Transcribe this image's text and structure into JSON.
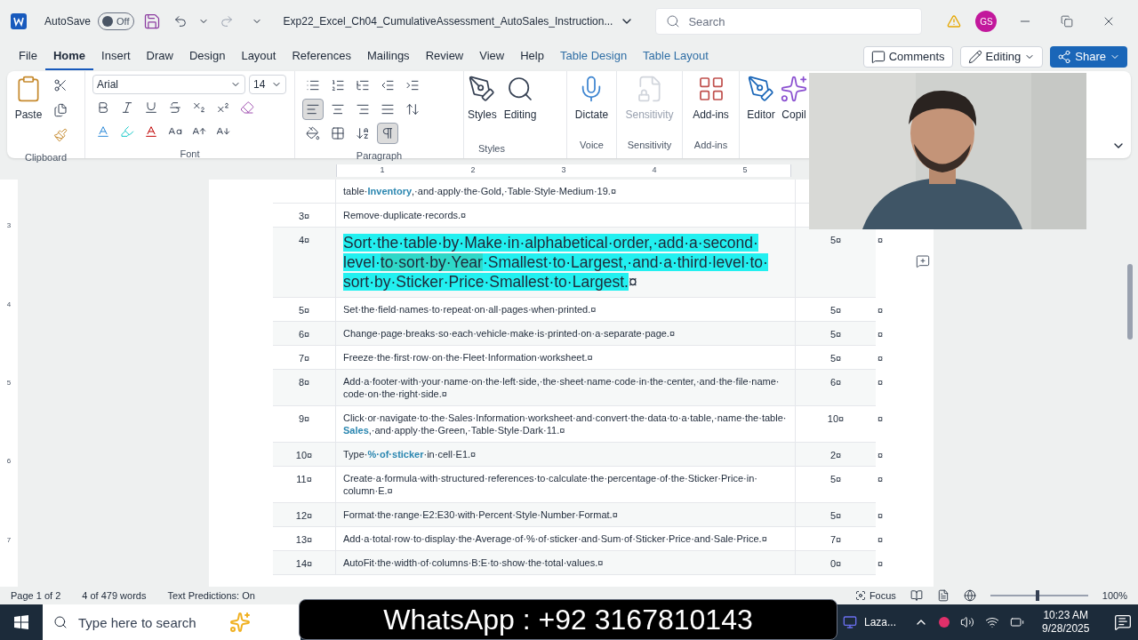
{
  "title_bar": {
    "autosave_label": "AutoSave",
    "autosave": {
      "on": false,
      "label": "Off"
    },
    "document_title": "Exp22_Excel_Ch04_CumulativeAssessment_AutoSales_Instruction...",
    "search": {
      "placeholder": "Search"
    },
    "avatar": "GS"
  },
  "tabs": [
    {
      "label": "File",
      "selected": false,
      "kind": "normal"
    },
    {
      "label": "Home",
      "selected": true,
      "kind": "normal"
    },
    {
      "label": "Insert",
      "selected": false,
      "kind": "normal"
    },
    {
      "label": "Draw",
      "selected": false,
      "kind": "normal"
    },
    {
      "label": "Design",
      "selected": false,
      "kind": "normal"
    },
    {
      "label": "Layout",
      "selected": false,
      "kind": "normal"
    },
    {
      "label": "References",
      "selected": false,
      "kind": "normal"
    },
    {
      "label": "Mailings",
      "selected": false,
      "kind": "normal"
    },
    {
      "label": "Review",
      "selected": false,
      "kind": "normal"
    },
    {
      "label": "View",
      "selected": false,
      "kind": "normal"
    },
    {
      "label": "Help",
      "selected": false,
      "kind": "normal"
    },
    {
      "label": "Table Design",
      "selected": false,
      "kind": "contextual"
    },
    {
      "label": "Table Layout",
      "selected": false,
      "kind": "contextual"
    }
  ],
  "tab_actions": {
    "comments": "Comments",
    "editing": "Editing",
    "share": "Share"
  },
  "ribbon": {
    "paste": "Paste",
    "font_name": "Arial",
    "font_size": "14",
    "align_buttons": [
      {
        "selected": true
      },
      {
        "selected": false
      },
      {
        "selected": false
      },
      {
        "selected": false
      }
    ],
    "show_marks": {
      "selected": true
    },
    "styles": "Styles",
    "editing": "Editing",
    "dictate": "Dictate",
    "sensitivity": {
      "label": "Sensitivity",
      "disabled": true
    },
    "addins": "Add-ins",
    "editor": "Editor",
    "copilot": "Copil",
    "group_labels": [
      "Clipboard",
      "Font",
      "Paragraph",
      "Styles",
      "Voice",
      "Sensitivity",
      "Add-ins"
    ]
  },
  "ruler": {
    "horizontal": [
      "1",
      "2",
      "3",
      "4",
      "5"
    ],
    "vertical": [
      "3",
      "4",
      "5",
      "6",
      "7"
    ]
  },
  "table": {
    "rows": [
      {
        "kind": "plain",
        "number": "",
        "text": "table·**Inventory**,·and·apply·the·Gold,·Table·Style·Medium·19.¤",
        "points": "",
        "end": ""
      },
      {
        "kind": "plain",
        "number": "3¤",
        "text": "Remove·duplicate·records.¤",
        "points": "",
        "end": ""
      },
      {
        "kind": "highlighted",
        "number": "4¤",
        "lines": [
          [
            {
              "text": "Sort·the·table·by·Make·in·alphabetical·order,·add·a·second·",
              "selected": false
            }
          ],
          [
            {
              "text": "level·",
              "selected": false
            },
            {
              "text": "to·sort·by·Year",
              "selected": true
            },
            {
              "text": "·Smallest·to·Largest,·and·a·third·level·to·",
              "selected": false
            }
          ],
          [
            {
              "text": "sort·by·Sticker·Price·Smallest·to·Largest.",
              "selected": false
            }
          ]
        ],
        "mark": "¤",
        "points": "5¤",
        "end": "¤"
      },
      {
        "kind": "plain",
        "number": "5¤",
        "text": "Set·the·field·names·to·repeat·on·all·pages·when·printed.¤",
        "points": "5¤",
        "end": "¤"
      },
      {
        "kind": "plain",
        "number": "6¤",
        "text": "Change·page·breaks·so·each·vehicle·make·is·printed·on·a·separate·page.¤",
        "points": "5¤",
        "end": "¤"
      },
      {
        "kind": "plain",
        "number": "7¤",
        "text": "Freeze·the·first·row·on·the·Fleet·Information·worksheet.¤",
        "points": "5¤",
        "end": "¤"
      },
      {
        "kind": "plain",
        "number": "8¤",
        "text": "Add·a·footer·with·your·name·on·the·left·side,·the·sheet·name·code·in·the·center,·and·the·file·name·code·on·the·right·side.¤",
        "points": "6¤",
        "end": "¤"
      },
      {
        "kind": "plain",
        "number": "9¤",
        "text": "Click·or·navigate·to·the·Sales·Information·worksheet·and·convert·the·data·to·a·table,·name·the·table·**Sales**,·and·apply·the·Green,·Table·Style·Dark·11.¤",
        "points": "10¤",
        "end": "¤"
      },
      {
        "kind": "plain",
        "number": "10¤",
        "text": "Type·**%·of·sticker**·in·cell·E1.¤",
        "points": "2¤",
        "end": "¤"
      },
      {
        "kind": "plain",
        "number": "11¤",
        "text": "Create·a·formula·with·structured·references·to·calculate·the·percentage·of·the·Sticker·Price·in·column·E.¤",
        "points": "5¤",
        "end": "¤"
      },
      {
        "kind": "plain",
        "number": "12¤",
        "text": "Format·the·range·E2:E30·with·Percent·Style·Number·Format.¤",
        "points": "5¤",
        "end": "¤"
      },
      {
        "kind": "plain",
        "number": "13¤",
        "text": "Add·a·total·row·to·display·the·Average·of·%·of·sticker·and·Sum·of·Sticker·Price·and·Sale·Price.¤",
        "points": "7¤",
        "end": "¤"
      },
      {
        "kind": "plain",
        "number": "14¤",
        "text": "AutoFit·the·width·of·columns·B:E·to·show·the·total·values.¤",
        "points": "0¤",
        "end": "¤"
      }
    ]
  },
  "status_bar": {
    "page": "Page 1 of 2",
    "words": "4 of 479 words",
    "predictions": "Text Predictions: On",
    "focus": "Focus",
    "zoom": {
      "level": 0.5
    },
    "zoom_label": "100%"
  },
  "taskbar": {
    "search": {
      "placeholder": "Type here to search"
    },
    "app": "Laza...",
    "time": "10:23 AM",
    "date": "9/28/2025"
  },
  "overlay_banner": "WhatsApp : +92 3167810143"
}
